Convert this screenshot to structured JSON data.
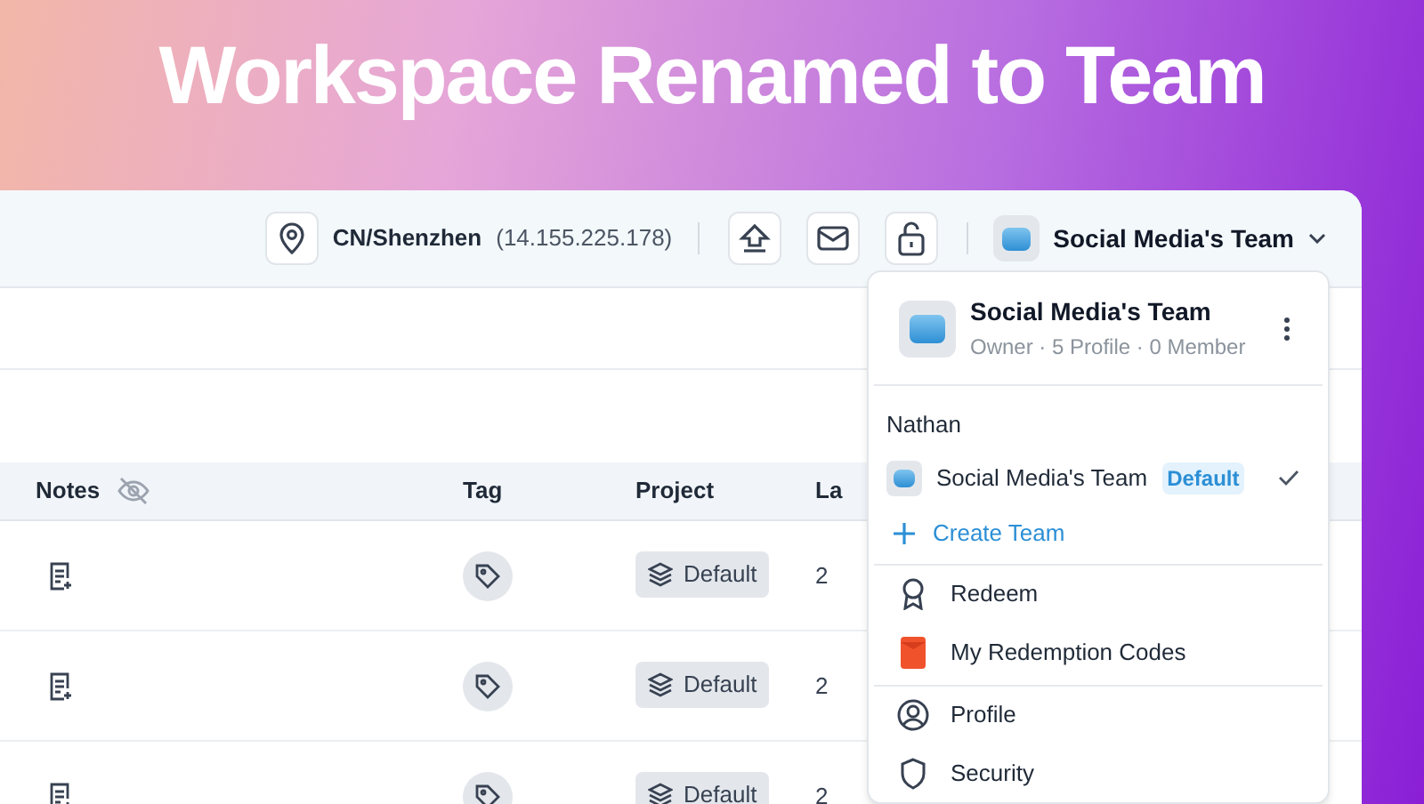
{
  "headline": "Workspace Renamed to Team",
  "toolbar": {
    "location": "CN/Shenzhen",
    "ip": "(14.155.225.178)",
    "team_name": "Social Media's Team"
  },
  "table": {
    "columns": [
      {
        "label": "Notes",
        "kind": "hidden"
      },
      {
        "label": "Tag",
        "kind": "plain"
      },
      {
        "label": "Project",
        "kind": "plain"
      },
      {
        "label": "La",
        "kind": "plain"
      }
    ],
    "rows": [
      {
        "project": "Default",
        "column_4": "2"
      },
      {
        "project": "Default",
        "column_4": "2"
      },
      {
        "project": "Default",
        "column_4": "2"
      }
    ]
  },
  "team_menu": {
    "title": "Social Media's Team",
    "subtitle": "Owner · 5 Profile · 0 Member",
    "group": "Nathan",
    "teams": [
      {
        "name": "Social Media's Team",
        "badge": "Default",
        "selected": true
      }
    ],
    "create": "Create Team",
    "items": [
      {
        "label": "Redeem",
        "kind": "redeem"
      },
      {
        "label": "My Redemption Codes",
        "kind": "codes"
      },
      {
        "label": "Profile",
        "kind": "profile",
        "divider": true
      },
      {
        "label": "Security",
        "kind": "security"
      }
    ]
  }
}
